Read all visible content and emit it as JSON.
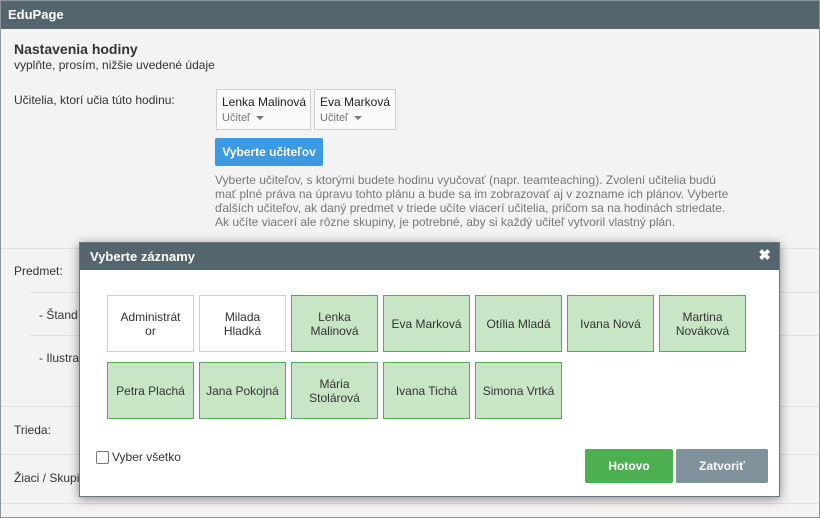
{
  "app": {
    "title": "EduPage"
  },
  "form": {
    "title": "Nastavenia hodiny",
    "subtitle": "vyplňte, prosím, nižšie uvedené údaje",
    "teachers_label": "Učitelia, ktorí učia túto hodinu:",
    "teachers": [
      {
        "name": "Lenka Malinová",
        "role": "Učiteľ"
      },
      {
        "name": "Eva Marková",
        "role": "Učiteľ"
      }
    ],
    "select_teachers_button": "Vyberte učiteľov",
    "help_text": "Vyberte učiteľov, s ktorými budete hodinu vyučovať (napr. teamteaching). Zvolení učitelia budú mať plné práva na úpravu tohto plánu a bude sa im zobrazovať aj v zozname ich plánov. Vyberte ďalších učiteľov, ak daný predmet v triede učíte viacerí učitelia, pričom sa na hodinách striedate. Ak učíte viacerí ale rôzne skupiny, je potrebné, aby si každý učiteľ vytvoril vlastný plán.",
    "subject_label": "Predmet:",
    "standard_label": "- Štand",
    "illustration_label": "- Ilustra",
    "class_label": "Trieda:",
    "students_label": "Žiaci / Skupi"
  },
  "modal": {
    "title": "Vyberte záznamy",
    "close_icon": "close-icon",
    "items": [
      {
        "label": "Administrát or",
        "selected": false
      },
      {
        "label": "Milada Hladká",
        "selected": false
      },
      {
        "label": "Lenka Malinová",
        "selected": true
      },
      {
        "label": "Eva Marková",
        "selected": true
      },
      {
        "label": "Otília Mladá",
        "selected": true
      },
      {
        "label": "Ivana Nová",
        "selected": true
      },
      {
        "label": "Martina Nováková",
        "selected": true
      },
      {
        "label": "Petra Plachá",
        "selected": true
      },
      {
        "label": "Jana Pokojná",
        "selected": true
      },
      {
        "label": "Mária Stolárová",
        "selected": true
      },
      {
        "label": "Ivana Tichá",
        "selected": true
      },
      {
        "label": "Simona Vrtká",
        "selected": true
      }
    ],
    "select_all_label": "Vyber všetko",
    "done_button": "Hotovo",
    "close_button": "Zatvoriť"
  },
  "colors": {
    "header_bg": "#55656d",
    "primary_blue": "#3b9ae1",
    "selected_tile": "#c8e6c6",
    "done_green": "#4caf50",
    "close_gray": "#7f929b"
  }
}
